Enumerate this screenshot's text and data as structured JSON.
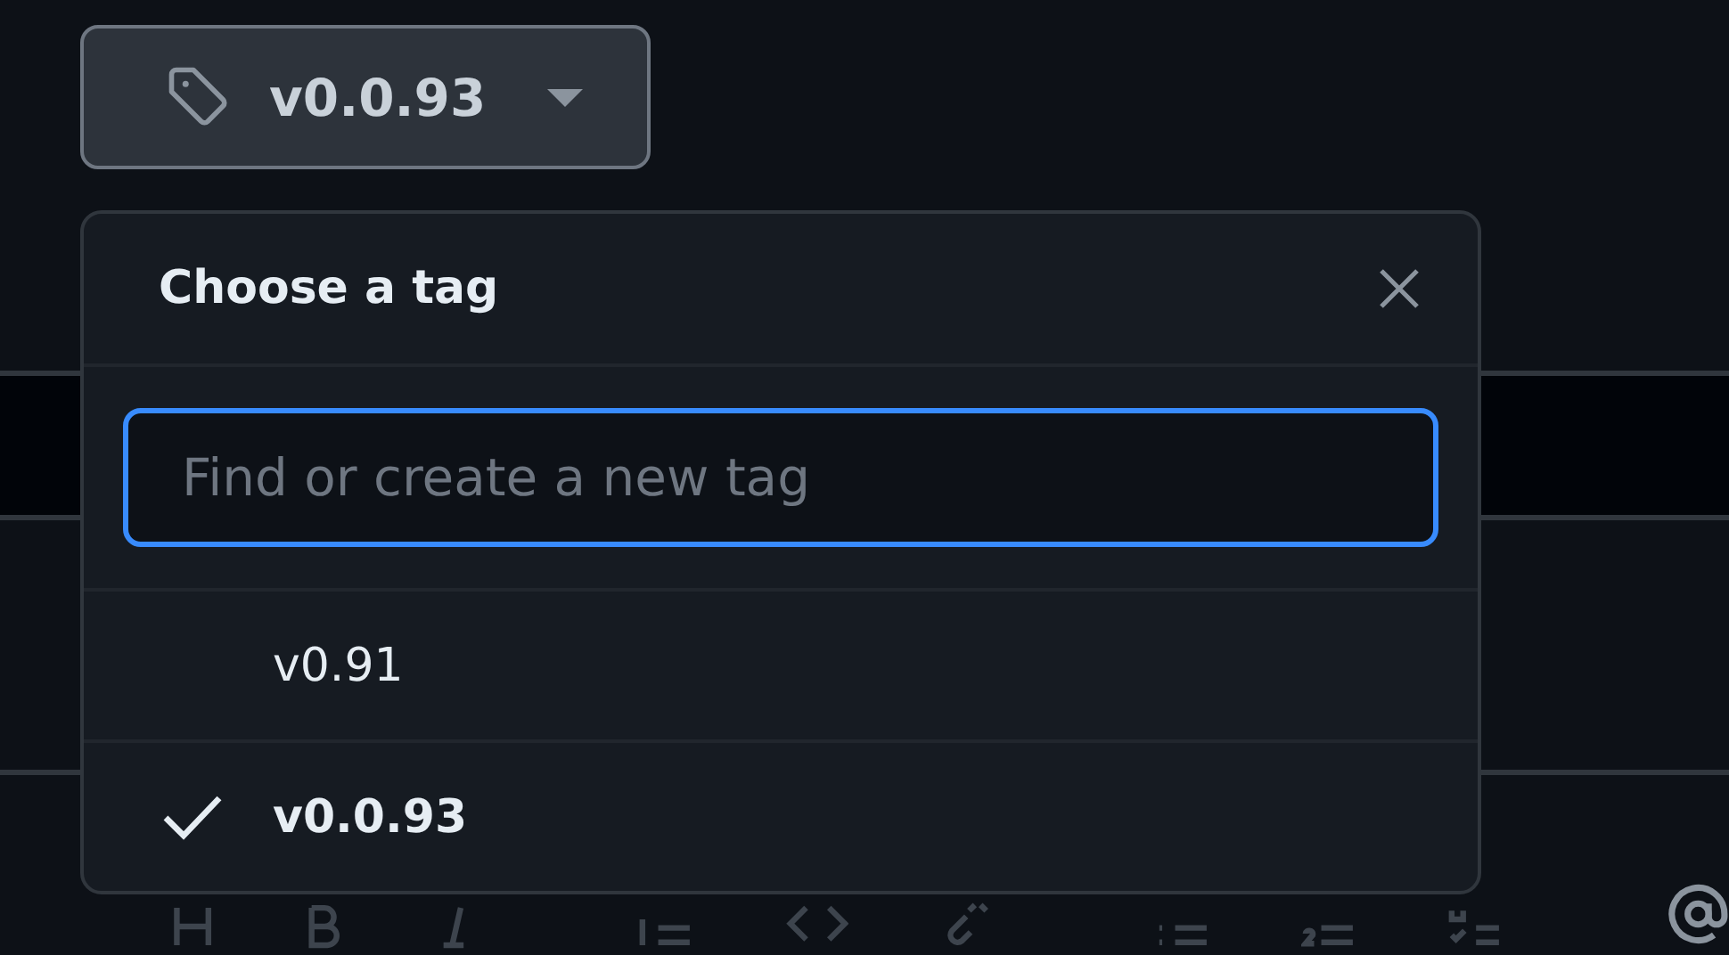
{
  "tag_button": {
    "label": "v0.0.93"
  },
  "tag_menu": {
    "title": "Choose a tag",
    "search": {
      "placeholder": "Find or create a new tag"
    },
    "items": [
      {
        "label": "v0.91",
        "selected": false
      },
      {
        "label": "v0.0.93",
        "selected": true
      }
    ]
  }
}
